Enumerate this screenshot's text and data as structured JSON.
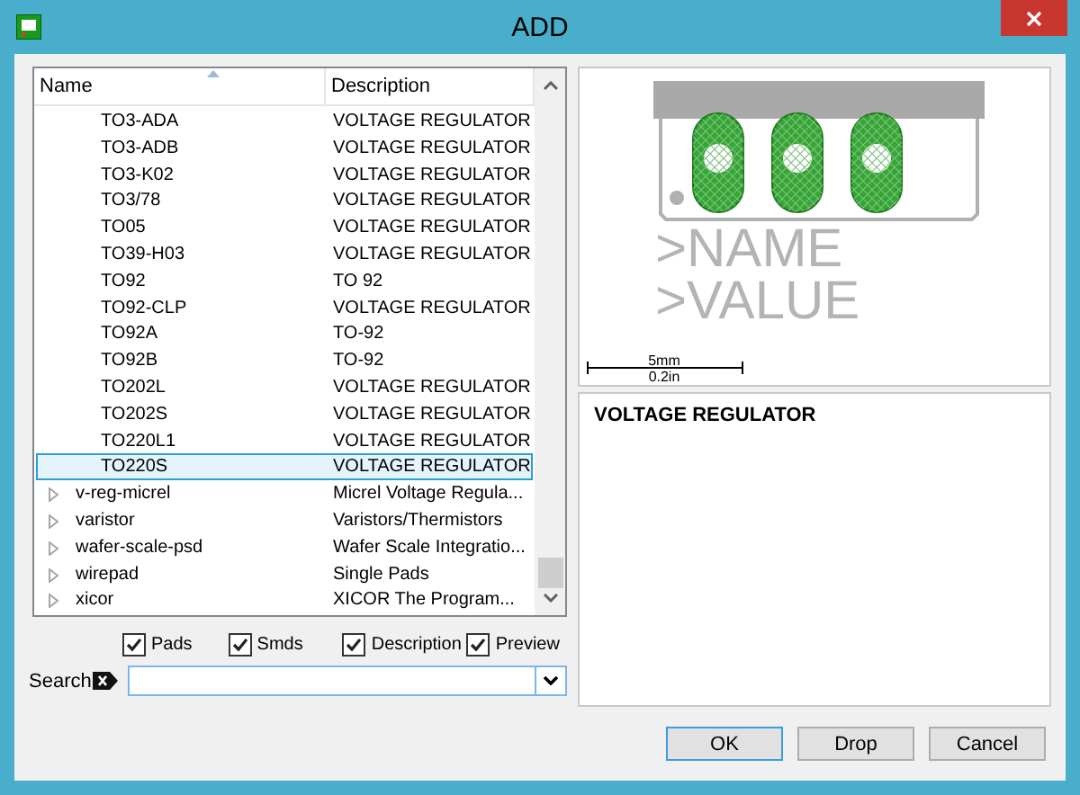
{
  "window": {
    "title": "ADD"
  },
  "tree": {
    "columns": [
      "Name",
      "Description"
    ],
    "rows": [
      {
        "kind": "leaf",
        "name": "TO3-ADA",
        "description": "VOLTAGE REGULATOR",
        "selected": false
      },
      {
        "kind": "leaf",
        "name": "TO3-ADB",
        "description": "VOLTAGE REGULATOR",
        "selected": false
      },
      {
        "kind": "leaf",
        "name": "TO3-K02",
        "description": "VOLTAGE REGULATOR",
        "selected": false
      },
      {
        "kind": "leaf",
        "name": "TO3/78",
        "description": "VOLTAGE REGULATOR",
        "selected": false
      },
      {
        "kind": "leaf",
        "name": "TO05",
        "description": "VOLTAGE REGULATOR",
        "selected": false
      },
      {
        "kind": "leaf",
        "name": "TO39-H03",
        "description": "VOLTAGE REGULATOR",
        "selected": false
      },
      {
        "kind": "leaf",
        "name": "TO92",
        "description": "TO 92",
        "selected": false
      },
      {
        "kind": "leaf",
        "name": "TO92-CLP",
        "description": "VOLTAGE REGULATOR",
        "selected": false
      },
      {
        "kind": "leaf",
        "name": "TO92A",
        "description": "TO-92",
        "selected": false
      },
      {
        "kind": "leaf",
        "name": "TO92B",
        "description": "TO-92",
        "selected": false
      },
      {
        "kind": "leaf",
        "name": "TO202L",
        "description": "VOLTAGE REGULATOR",
        "selected": false
      },
      {
        "kind": "leaf",
        "name": "TO202S",
        "description": "VOLTAGE REGULATOR",
        "selected": false
      },
      {
        "kind": "leaf",
        "name": "TO220L1",
        "description": "VOLTAGE REGULATOR",
        "selected": false
      },
      {
        "kind": "leaf",
        "name": "TO220S",
        "description": "VOLTAGE REGULATOR",
        "selected": true
      },
      {
        "kind": "group",
        "name": "v-reg-micrel",
        "description": "Micrel Voltage Regula...",
        "selected": false
      },
      {
        "kind": "group",
        "name": "varistor",
        "description": "Varistors/Thermistors",
        "selected": false
      },
      {
        "kind": "group",
        "name": "wafer-scale-psd",
        "description": "Wafer Scale Integratio...",
        "selected": false
      },
      {
        "kind": "group",
        "name": "wirepad",
        "description": "Single Pads",
        "selected": false
      },
      {
        "kind": "group",
        "name": "xicor",
        "description": "XICOR The Program...",
        "selected": false
      }
    ]
  },
  "options": [
    {
      "label": "Pads",
      "checked": true
    },
    {
      "label": "Smds",
      "checked": true
    },
    {
      "label": "Description",
      "checked": true
    },
    {
      "label": "Preview",
      "checked": true
    }
  ],
  "search": {
    "label": "Search"
  },
  "preview": {
    "name_text": ">NAME",
    "value_text": ">VALUE",
    "scale_mm": "5mm",
    "scale_in": "0.2in"
  },
  "description": {
    "text": "VOLTAGE REGULATOR"
  },
  "buttons": [
    {
      "label": "OK",
      "default": true
    },
    {
      "label": "Drop",
      "default": false
    },
    {
      "label": "Cancel",
      "default": false
    }
  ]
}
